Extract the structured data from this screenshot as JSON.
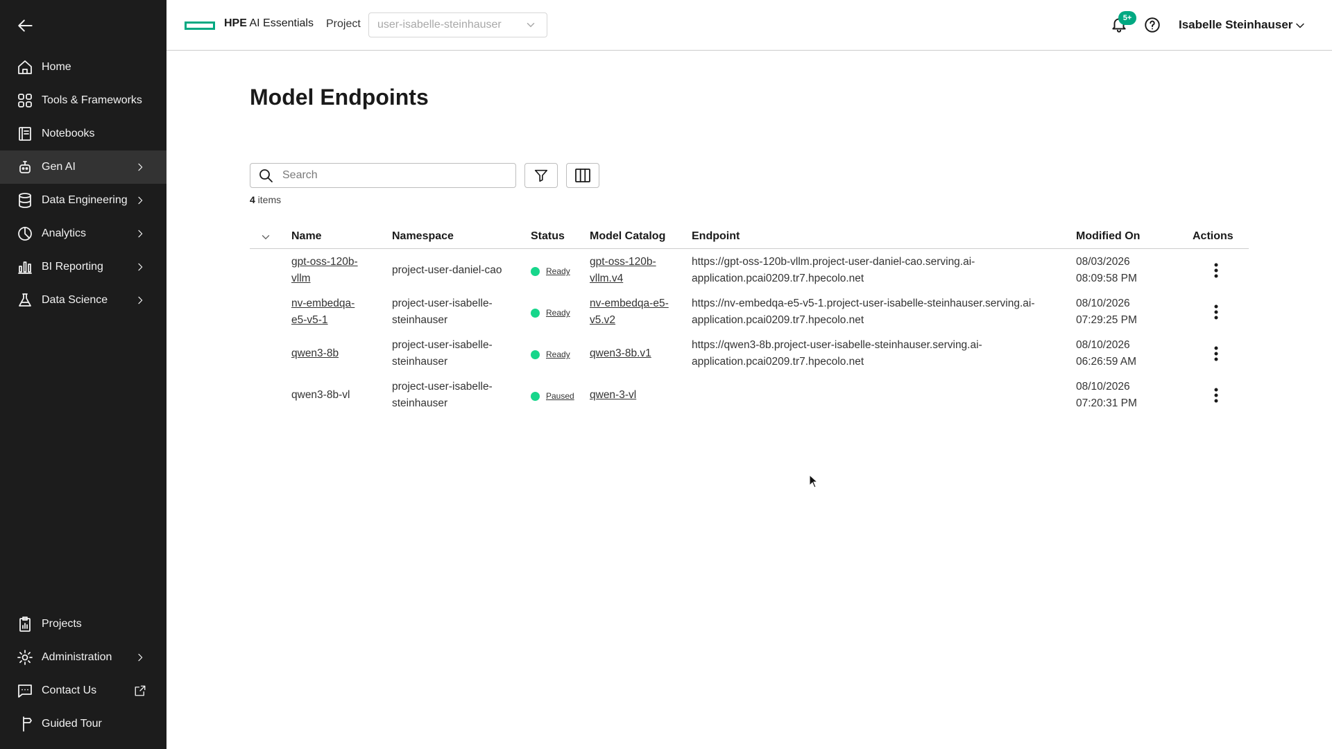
{
  "header": {
    "brand_bold": "HPE",
    "brand_rest": " AI Essentials",
    "project_label": "Project",
    "project_value": "user-isabelle-steinhauser",
    "notification_badge": "5+",
    "user_name": "Isabelle Steinhauser"
  },
  "sidebar": {
    "items": [
      {
        "label": "Home",
        "icon": "home-icon"
      },
      {
        "label": "Tools & Frameworks",
        "icon": "grid-icon"
      },
      {
        "label": "Notebooks",
        "icon": "notebook-icon"
      },
      {
        "label": "Gen AI",
        "icon": "robot-icon"
      },
      {
        "label": "Data Engineering",
        "icon": "database-icon"
      },
      {
        "label": "Analytics",
        "icon": "pie-chart-icon"
      },
      {
        "label": "BI Reporting",
        "icon": "bar-chart-icon"
      },
      {
        "label": "Data Science",
        "icon": "flask-icon"
      }
    ],
    "bottom_items": [
      {
        "label": "Projects",
        "icon": "clipboard-icon"
      },
      {
        "label": "Administration",
        "icon": "gear-icon"
      },
      {
        "label": "Contact Us",
        "icon": "chat-icon"
      },
      {
        "label": "Guided Tour",
        "icon": "signpost-icon"
      }
    ]
  },
  "main": {
    "title": "Model Endpoints",
    "search_placeholder": "Search",
    "items_count": "4",
    "items_label": " items",
    "columns": [
      "Name",
      "Namespace",
      "Status",
      "Model Catalog",
      "Endpoint",
      "Modified On",
      "Actions"
    ],
    "rows": [
      {
        "name": [
          "gpt-oss-120b-",
          "vllm"
        ],
        "namespace": [
          "project-user-daniel-cao"
        ],
        "status": "Ready",
        "catalog": [
          "gpt-oss-120b-",
          "vllm.v4"
        ],
        "endpoint": [
          "https://gpt-oss-120b-vllm.project-user-daniel-cao.serving.ai-",
          "application.pcai0209.tr7.hpecolo.net"
        ],
        "modified": [
          "08/03/2026",
          "08:09:58 PM"
        ]
      },
      {
        "name": [
          "nv-embedqa-",
          "e5-v5-1"
        ],
        "namespace": [
          "project-user-isabelle-",
          "steinhauser"
        ],
        "status": "Ready",
        "catalog": [
          "nv-embedqa-e5-",
          "v5.v2"
        ],
        "endpoint": [
          "https://nv-embedqa-e5-v5-1.project-user-isabelle-steinhauser.serving.ai-",
          "application.pcai0209.tr7.hpecolo.net"
        ],
        "modified": [
          "08/10/2026",
          "07:29:25 PM"
        ]
      },
      {
        "name": [
          "qwen3-8b"
        ],
        "namespace": [
          "project-user-isabelle-",
          "steinhauser"
        ],
        "status": "Ready",
        "catalog": [
          "qwen3-8b.v1"
        ],
        "endpoint": [
          "https://qwen3-8b.project-user-isabelle-steinhauser.serving.ai-",
          "application.pcai0209.tr7.hpecolo.net"
        ],
        "modified": [
          "08/10/2026",
          "06:26:59 AM"
        ]
      },
      {
        "name": [
          "qwen3-8b-vl"
        ],
        "namespace": [
          "project-user-isabelle-",
          "steinhauser"
        ],
        "status": "Paused",
        "catalog": [
          "qwen-3-vl"
        ],
        "endpoint": [],
        "modified": [
          "08/10/2026",
          "07:20:31 PM"
        ]
      }
    ]
  },
  "colors": {
    "sidebar_bg": "#1c1c1c",
    "active_item_bg": "#333333",
    "brand_green": "#01a982",
    "status_green": "#17d68b"
  }
}
